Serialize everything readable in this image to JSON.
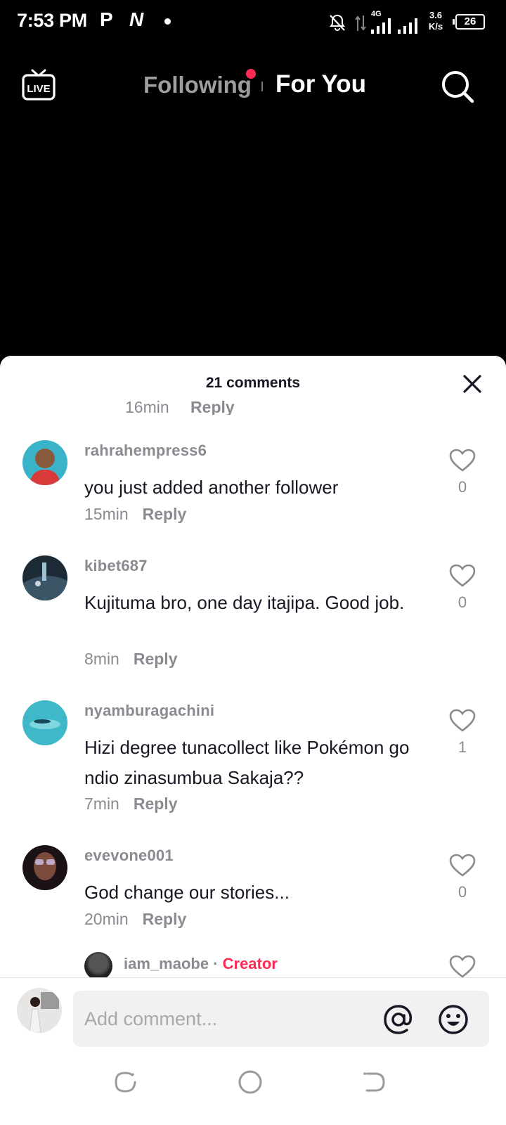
{
  "status_bar": {
    "time": "7:53 PM",
    "notif_p": "P",
    "notif_n": "N",
    "network": "4G",
    "speed_value": "3.6",
    "speed_unit": "K/s",
    "battery": "26"
  },
  "top_nav": {
    "live_label": "LIVE",
    "following_label": "Following",
    "for_you_label": "For You"
  },
  "sheet": {
    "title": "21 comments",
    "partial_top": {
      "time": "16min",
      "reply_label": "Reply"
    },
    "comments": [
      {
        "user": "rahrahempress6",
        "text": "you just added another follower",
        "time": "15min",
        "reply_label": "Reply",
        "likes": "0"
      },
      {
        "user": "kibet687",
        "text": "Kujituma bro, one day itajipa. Good job.",
        "time": "8min",
        "reply_label": "Reply",
        "likes": "0"
      },
      {
        "user": "nyamburagachini",
        "text": "Hizi degree tunacollect like Pokémon go ndio zinasumbua Sakaja??",
        "time": "7min",
        "reply_label": "Reply",
        "likes": "1"
      },
      {
        "user": "evevone001",
        "text": "God change our stories...",
        "time": "20min",
        "reply_label": "Reply",
        "likes": "0"
      }
    ],
    "partial_bottom": {
      "user": "iam_maobe",
      "separator": " · ",
      "badge": "Creator"
    }
  },
  "composer": {
    "placeholder": "Add comment..."
  },
  "colors": {
    "accent": "#fe2c55",
    "text_primary": "#161823",
    "text_secondary": "#8a8b91",
    "input_bg": "#f1f1f2"
  },
  "icons": {
    "live": "live-tv-icon",
    "search": "search-icon",
    "close": "close-icon",
    "like": "heart-outline-icon",
    "mention": "at-sign-icon",
    "emoji": "smiley-icon",
    "nav_recent": "recents-icon",
    "nav_home": "home-circle-icon",
    "nav_back": "back-icon"
  }
}
